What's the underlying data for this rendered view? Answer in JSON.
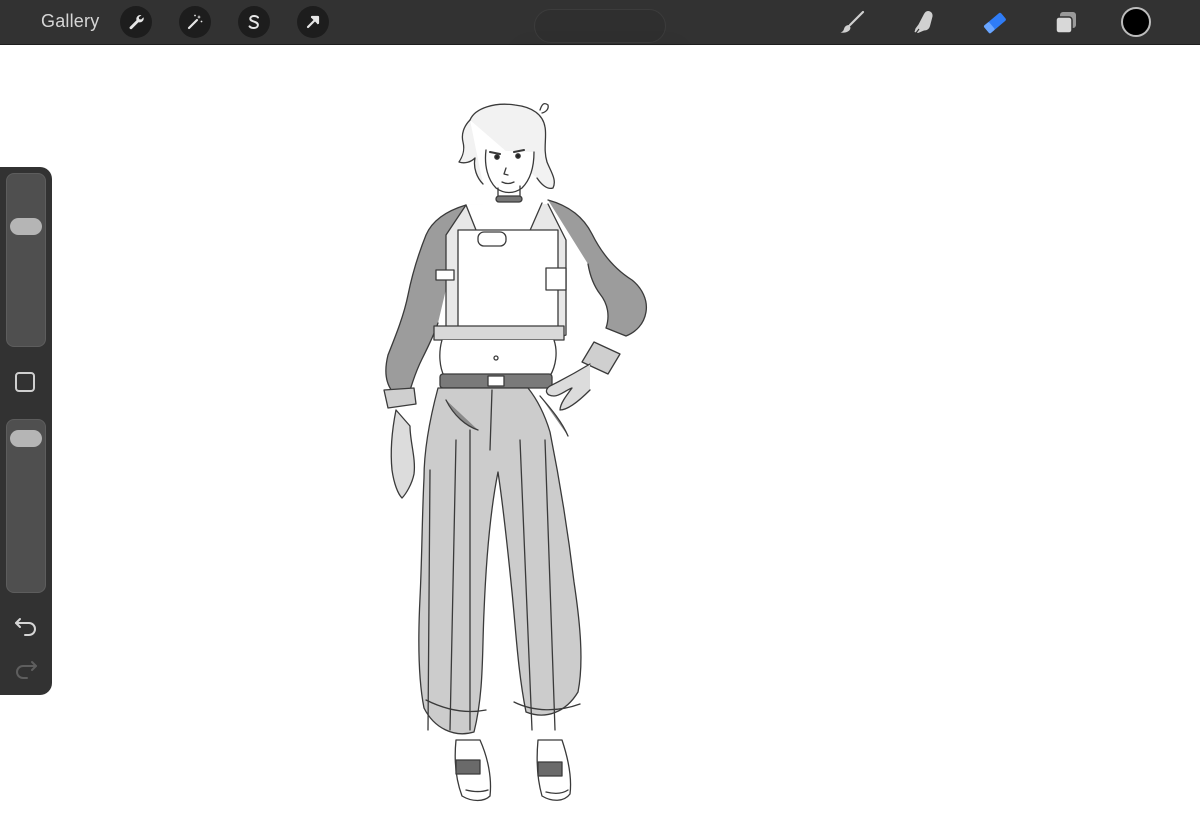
{
  "toolbar": {
    "gallery_label": "Gallery",
    "left_tools": [
      {
        "name": "actions",
        "icon": "wrench-icon"
      },
      {
        "name": "adjustments",
        "icon": "magic-wand-icon"
      },
      {
        "name": "selection",
        "icon": "selection-s-icon"
      },
      {
        "name": "transform",
        "icon": "arrow-cursor-icon"
      }
    ],
    "right_tools": [
      {
        "name": "brush",
        "icon": "brush-icon"
      },
      {
        "name": "smudge",
        "icon": "smudge-finger-icon"
      },
      {
        "name": "eraser",
        "icon": "eraser-icon",
        "active": true
      },
      {
        "name": "layers",
        "icon": "layers-icon"
      }
    ],
    "active_tool_color": "#2f7cf6",
    "current_color": "#000000"
  },
  "sidebar": {
    "brush_size_level": 0.73,
    "opacity_level": 0.96,
    "undo_icon": "undo-arrow-icon",
    "redo_icon": "redo-arrow-icon"
  },
  "canvas": {
    "background": "#ffffff",
    "artwork": "pencil-sketch-figure"
  }
}
